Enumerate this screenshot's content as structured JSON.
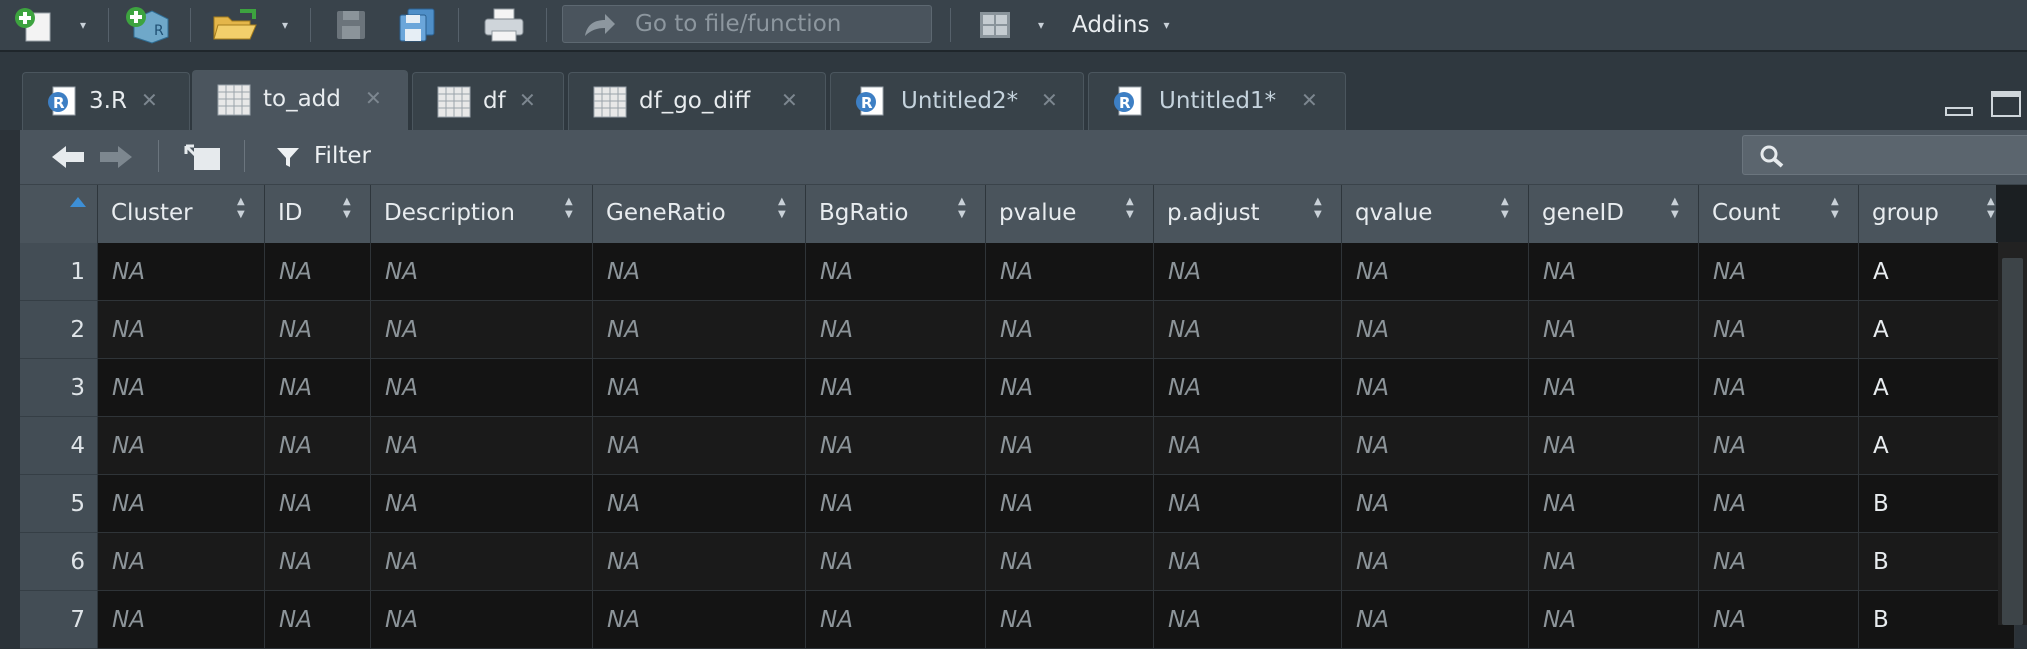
{
  "toolbar": {
    "goto_placeholder": "Go to file/function",
    "addins_label": "Addins",
    "icons": [
      "new-file-icon",
      "new-project-icon",
      "open-file-icon",
      "save-icon",
      "save-all-icon",
      "print-icon",
      "grid-layout-icon"
    ]
  },
  "tabs": [
    {
      "label": "3.R",
      "icon": "r-script-icon",
      "active": false
    },
    {
      "label": "to_add",
      "icon": "data-table-icon",
      "active": true
    },
    {
      "label": "df",
      "icon": "data-table-icon",
      "active": false
    },
    {
      "label": "df_go_diff",
      "icon": "data-table-icon",
      "active": false
    },
    {
      "label": "Untitled2*",
      "icon": "r-script-icon",
      "active": false
    },
    {
      "label": "Untitled1*",
      "icon": "r-script-icon",
      "active": false
    }
  ],
  "viewer_toolbar": {
    "filter_label": "Filter"
  },
  "table": {
    "columns": [
      "Cluster",
      "ID",
      "Description",
      "GeneRatio",
      "BgRatio",
      "pvalue",
      "p.adjust",
      "qvalue",
      "geneID",
      "Count",
      "group"
    ],
    "rows": [
      {
        "n": "1",
        "cells": [
          "NA",
          "NA",
          "NA",
          "NA",
          "NA",
          "NA",
          "NA",
          "NA",
          "NA",
          "NA",
          "A"
        ]
      },
      {
        "n": "2",
        "cells": [
          "NA",
          "NA",
          "NA",
          "NA",
          "NA",
          "NA",
          "NA",
          "NA",
          "NA",
          "NA",
          "A"
        ]
      },
      {
        "n": "3",
        "cells": [
          "NA",
          "NA",
          "NA",
          "NA",
          "NA",
          "NA",
          "NA",
          "NA",
          "NA",
          "NA",
          "A"
        ]
      },
      {
        "n": "4",
        "cells": [
          "NA",
          "NA",
          "NA",
          "NA",
          "NA",
          "NA",
          "NA",
          "NA",
          "NA",
          "NA",
          "A"
        ]
      },
      {
        "n": "5",
        "cells": [
          "NA",
          "NA",
          "NA",
          "NA",
          "NA",
          "NA",
          "NA",
          "NA",
          "NA",
          "NA",
          "B"
        ]
      },
      {
        "n": "6",
        "cells": [
          "NA",
          "NA",
          "NA",
          "NA",
          "NA",
          "NA",
          "NA",
          "NA",
          "NA",
          "NA",
          "B"
        ]
      },
      {
        "n": "7",
        "cells": [
          "NA",
          "NA",
          "NA",
          "NA",
          "NA",
          "NA",
          "NA",
          "NA",
          "NA",
          "NA",
          "B"
        ]
      }
    ]
  },
  "colors": {
    "toolbar_bg": "#39434b",
    "grid_bg": "#141414",
    "header_bg": "#4a545c",
    "na_text": "#8c9499",
    "accent_blue": "#3d8fd6"
  }
}
